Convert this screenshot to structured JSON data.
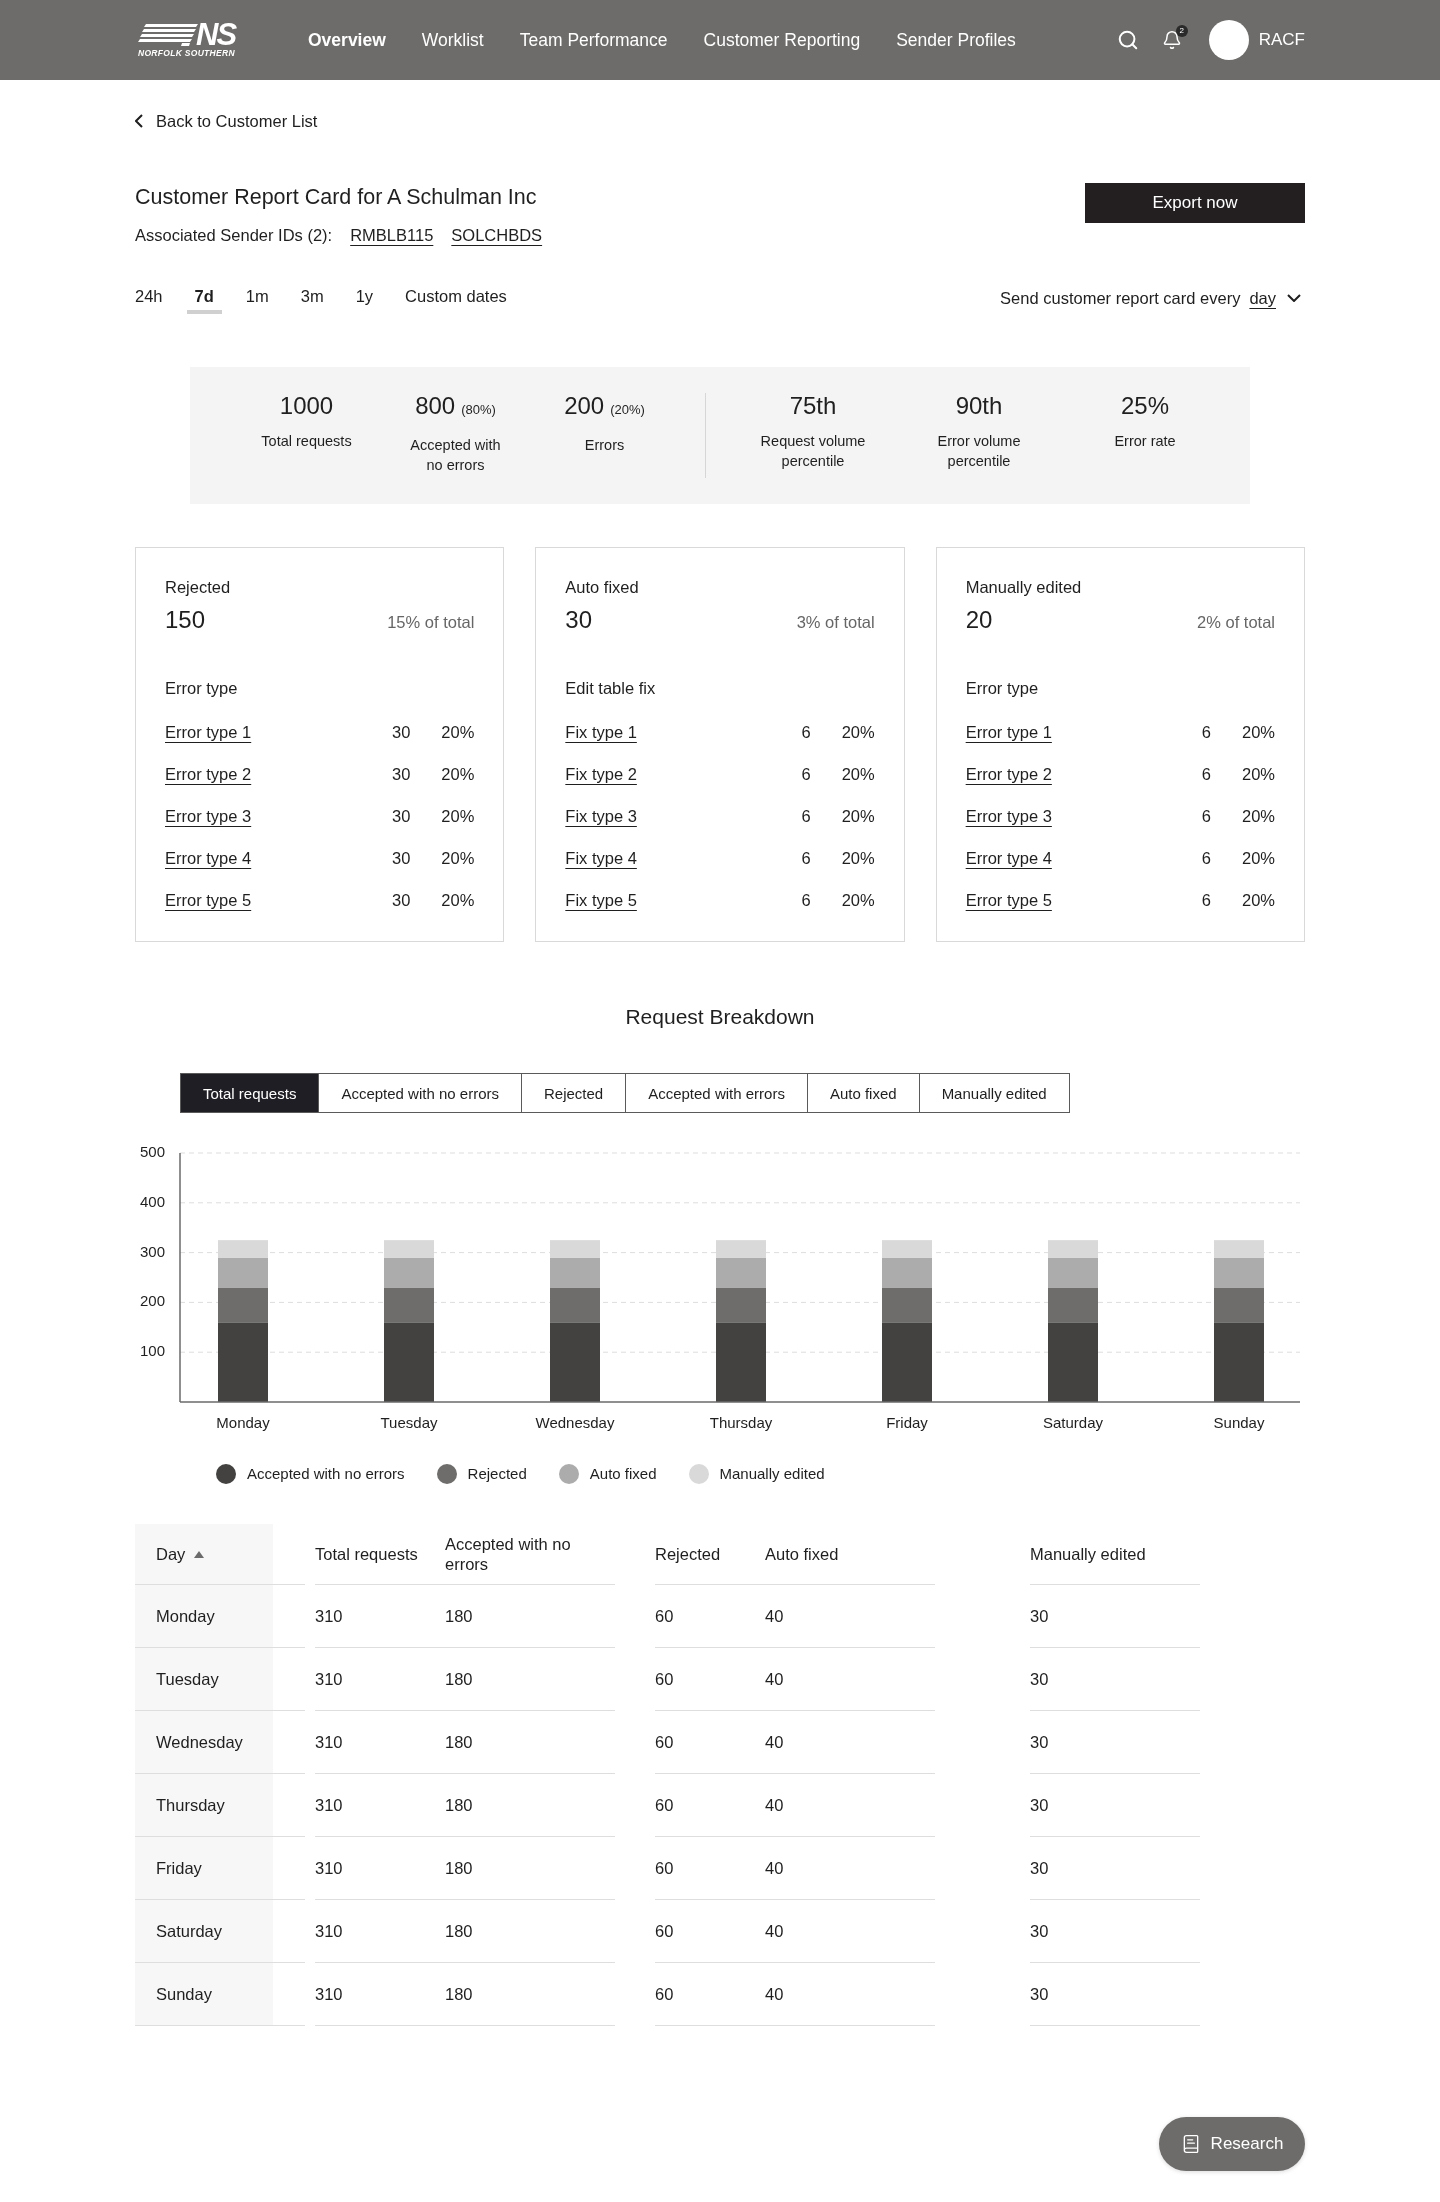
{
  "nav": {
    "logo": {
      "mark": "NS",
      "wordmark": "NORFOLK SOUTHERN"
    },
    "items": [
      {
        "label": "Overview",
        "selected": true
      },
      {
        "label": "Worklist",
        "selected": false
      },
      {
        "label": "Team Performance",
        "selected": false
      },
      {
        "label": "Customer Reporting",
        "selected": false
      },
      {
        "label": "Sender Profiles",
        "selected": false
      }
    ],
    "notifications": "2",
    "user": "RACF"
  },
  "back_link": "Back to Customer List",
  "report": {
    "title": "Customer Report Card for A Schulman Inc",
    "sender_ids_label": "Associated Sender IDs (2):",
    "sender_ids": [
      "RMBLB115",
      "SOLCHBDS"
    ],
    "export_button": "Export now"
  },
  "time_ranges": [
    {
      "label": "24h",
      "selected": false
    },
    {
      "label": "7d",
      "selected": true
    },
    {
      "label": "1m",
      "selected": false
    },
    {
      "label": "3m",
      "selected": false
    },
    {
      "label": "1y",
      "selected": false
    },
    {
      "label": "Custom dates",
      "selected": false
    }
  ],
  "schedule": {
    "label": "Send customer report card every",
    "value": "day"
  },
  "summary": {
    "volume": [
      {
        "value": "1000",
        "label": "Total requests"
      },
      {
        "value": "800",
        "share": "(80%)",
        "label": "Accepted with no errors"
      },
      {
        "value": "200",
        "share": "(20%)",
        "label": "Errors"
      }
    ],
    "percentiles": [
      {
        "value": "75th",
        "label": "Request volume percentile"
      },
      {
        "value": "90th",
        "label": "Error volume percentile"
      },
      {
        "value": "25%",
        "label": "Error rate"
      }
    ]
  },
  "cards": [
    {
      "title": "Rejected",
      "count": "150",
      "share": "15% of total",
      "list_heading": "Error type",
      "rows": [
        {
          "label": "Error type 1",
          "count": "30",
          "share": "20%"
        },
        {
          "label": "Error type 2",
          "count": "30",
          "share": "20%"
        },
        {
          "label": "Error type 3",
          "count": "30",
          "share": "20%"
        },
        {
          "label": "Error type 4",
          "count": "30",
          "share": "20%"
        },
        {
          "label": "Error type 5",
          "count": "30",
          "share": "20%"
        }
      ]
    },
    {
      "title": "Auto fixed",
      "count": "30",
      "share": "3% of total",
      "list_heading": "Edit table fix",
      "rows": [
        {
          "label": "Fix type 1",
          "count": "6",
          "share": "20%"
        },
        {
          "label": "Fix type 2",
          "count": "6",
          "share": "20%"
        },
        {
          "label": "Fix type 3",
          "count": "6",
          "share": "20%"
        },
        {
          "label": "Fix type 4",
          "count": "6",
          "share": "20%"
        },
        {
          "label": "Fix type 5",
          "count": "6",
          "share": "20%"
        }
      ]
    },
    {
      "title": "Manually edited",
      "count": "20",
      "share": "2% of total",
      "list_heading": "Error type",
      "rows": [
        {
          "label": "Error type 1",
          "count": "6",
          "share": "20%"
        },
        {
          "label": "Error type 2",
          "count": "6",
          "share": "20%"
        },
        {
          "label": "Error type 3",
          "count": "6",
          "share": "20%"
        },
        {
          "label": "Error type 4",
          "count": "6",
          "share": "20%"
        },
        {
          "label": "Error type 5",
          "count": "6",
          "share": "20%"
        }
      ]
    }
  ],
  "breakdown": {
    "title": "Request Breakdown",
    "tabs": [
      {
        "label": "Total requests",
        "selected": true
      },
      {
        "label": "Accepted with no errors",
        "selected": false
      },
      {
        "label": "Rejected",
        "selected": false
      },
      {
        "label": "Accepted with errors",
        "selected": false
      },
      {
        "label": "Auto fixed",
        "selected": false
      },
      {
        "label": "Manually edited",
        "selected": false
      }
    ],
    "chart_data": {
      "type": "bar",
      "stacked": true,
      "grid": true,
      "categories": [
        "Monday",
        "Tuesday",
        "Wednesday",
        "Thursday",
        "Friday",
        "Saturday",
        "Sunday"
      ],
      "series": [
        {
          "name": "Accepted with no errors",
          "color": "#434241",
          "values": [
            160,
            160,
            160,
            160,
            160,
            160,
            160
          ]
        },
        {
          "name": "Rejected",
          "color": "#6e6d6b",
          "values": [
            70,
            70,
            70,
            70,
            70,
            70,
            70
          ]
        },
        {
          "name": "Auto fixed",
          "color": "#acacac",
          "values": [
            60,
            60,
            60,
            60,
            60,
            60,
            60
          ]
        },
        {
          "name": "Manually edited",
          "color": "#d9d9d9",
          "values": [
            35,
            35,
            35,
            35,
            35,
            35,
            35
          ]
        }
      ],
      "ylim": [
        0,
        500
      ],
      "yticks": [
        100,
        200,
        300,
        400,
        500
      ]
    }
  },
  "table": {
    "columns": [
      {
        "label": "Day",
        "sorted": true
      },
      {
        "label": "Total requests",
        "sorted": false
      },
      {
        "label": "Accepted with no errors",
        "sorted": false
      },
      {
        "label": "Rejected",
        "sorted": false
      },
      {
        "label": "Auto fixed",
        "sorted": false
      },
      {
        "label": "Manually edited",
        "sorted": false
      }
    ],
    "rows": [
      [
        "Monday",
        "310",
        "180",
        "60",
        "40",
        "30"
      ],
      [
        "Tuesday",
        "310",
        "180",
        "60",
        "40",
        "30"
      ],
      [
        "Wednesday",
        "310",
        "180",
        "60",
        "40",
        "30"
      ],
      [
        "Thursday",
        "310",
        "180",
        "60",
        "40",
        "30"
      ],
      [
        "Friday",
        "310",
        "180",
        "60",
        "40",
        "30"
      ],
      [
        "Saturday",
        "310",
        "180",
        "60",
        "40",
        "30"
      ],
      [
        "Sunday",
        "310",
        "180",
        "60",
        "40",
        "30"
      ]
    ]
  },
  "research_button": "Research"
}
